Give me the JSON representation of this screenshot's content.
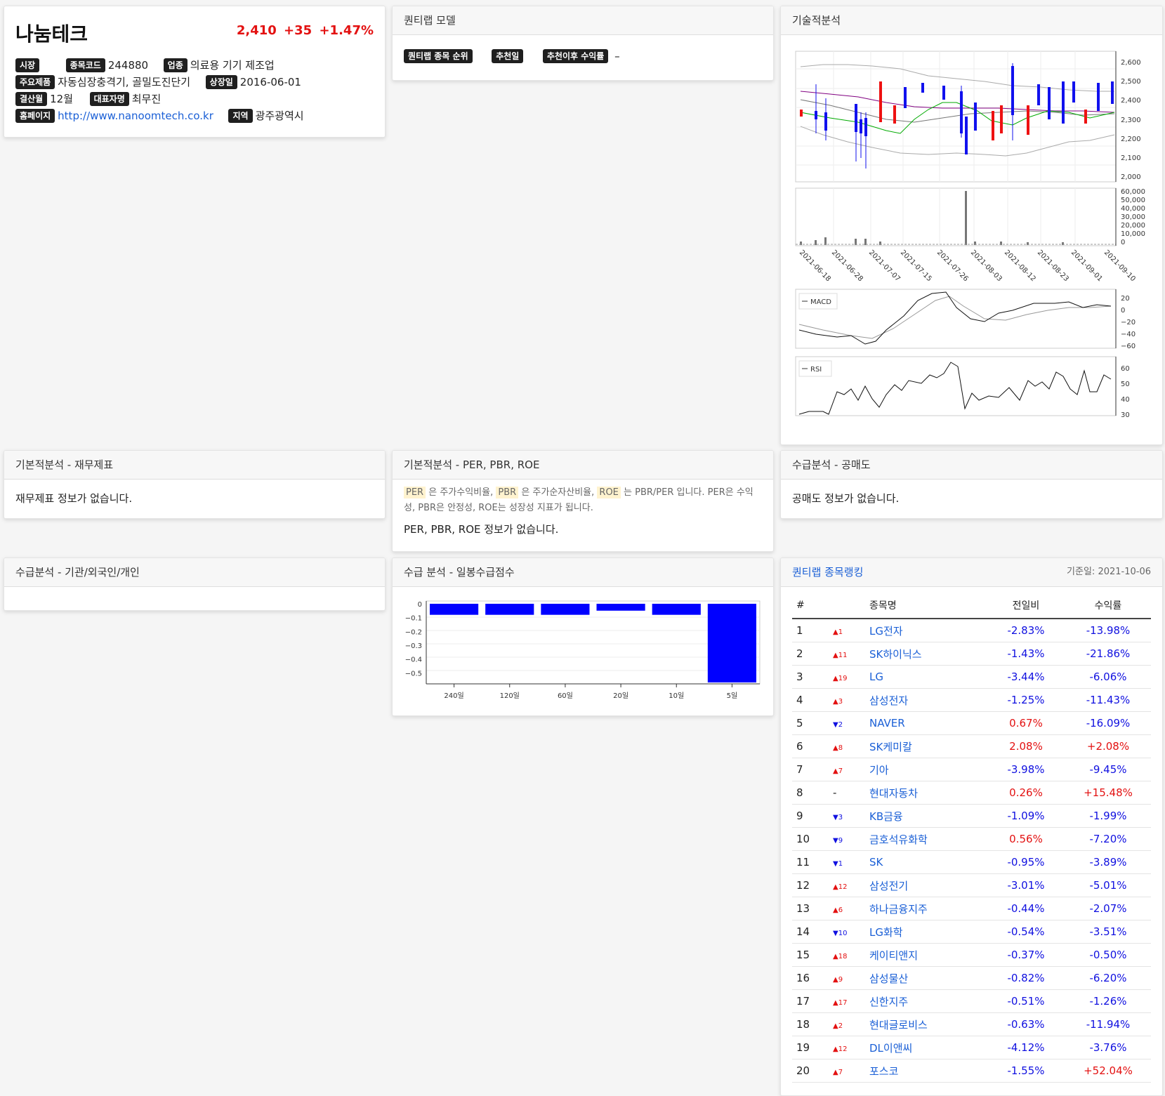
{
  "stock": {
    "name": "나눔테크",
    "price": "2,410",
    "change": "+35",
    "change_pct": "+1.47%",
    "market_label": "시장",
    "code_label": "종목코드",
    "code": "244880",
    "industry_label": "업종",
    "industry": "의료용 기기 제조업",
    "product_label": "주요제품",
    "product": "자동심장충격기, 골밀도진단기",
    "listing_label": "상장일",
    "listing_date": "2016-06-01",
    "fiscal_label": "결산월",
    "fiscal": "12월",
    "ceo_label": "대표자명",
    "ceo": "최무진",
    "homepage_label": "홈페이지",
    "homepage": "http://www.nanoomtech.co.kr",
    "region_label": "지역",
    "region": "광주광역시"
  },
  "quant_model": {
    "title": "퀀티랩 모델",
    "rank_badge": "퀀티랩 종목 순위",
    "date_badge": "추천일",
    "return_badge": "추천이후 수익률",
    "return_value": "–"
  },
  "tech": {
    "title": "기술적분석",
    "price_ticks": [
      "2,600",
      "2,500",
      "2,400",
      "2,300",
      "2,200",
      "2,100",
      "2,000"
    ],
    "volume_ticks": [
      "60,000",
      "50,000",
      "40,000",
      "30,000",
      "20,000",
      "10,000",
      "0"
    ],
    "date_ticks": [
      "2021-06-18",
      "2021-06-28",
      "2021-07-07",
      "2021-07-15",
      "2021-07-26",
      "2021-08-03",
      "2021-08-12",
      "2021-08-23",
      "2021-09-01",
      "2021-09-10"
    ],
    "macd_label": "MACD",
    "macd_ticks": [
      "20",
      "0",
      "−20",
      "−40",
      "−60"
    ],
    "rsi_label": "RSI",
    "rsi_ticks": [
      "60",
      "50",
      "40",
      "30"
    ]
  },
  "fin": {
    "title": "기본적분석 - 재무제표",
    "empty": "재무제표 정보가 없습니다."
  },
  "per": {
    "title": "기본적분석 - PER, PBR, ROE",
    "per": "PER",
    "per_text": "은 주가수익비율,",
    "pbr": "PBR",
    "pbr_text": "은 주가순자산비율,",
    "roe": "ROE",
    "roe_text": "는 PBR/PER 입니다. PER은 수익성, PBR은 안정성, ROE는 성장성 지표가 됩니다.",
    "empty": "PER, PBR, ROE 정보가 없습니다."
  },
  "short": {
    "title": "수급분석 - 공매도",
    "empty": "공매도 정보가 없습니다."
  },
  "investor": {
    "title": "수급분석 - 기관/외국인/개인"
  },
  "supply": {
    "title": "수급 분석 - 일봉수급점수",
    "y_ticks": [
      "0",
      "−0.1",
      "−0.2",
      "−0.3",
      "−0.4",
      "−0.5"
    ]
  },
  "supply_chart": {
    "type": "bar",
    "categories": [
      "240일",
      "120일",
      "60일",
      "20일",
      "10일",
      "5일"
    ],
    "values": [
      -0.08,
      -0.08,
      -0.08,
      -0.05,
      -0.08,
      -0.57
    ],
    "ylim": [
      -0.58,
      0.02
    ],
    "color": "#0000ff"
  },
  "ranking": {
    "title": "퀀티랩 종목랭킹",
    "date": "기준일: 2021-10-06",
    "headers": [
      "#",
      "종목명",
      "전일비",
      "수익률"
    ],
    "rows": [
      {
        "rank": "1",
        "dir": "up",
        "move": "1",
        "name": "LG전자",
        "chg": "-2.83%",
        "ret": "-13.98%"
      },
      {
        "rank": "2",
        "dir": "up",
        "move": "11",
        "name": "SK하이닉스",
        "chg": "-1.43%",
        "ret": "-21.86%"
      },
      {
        "rank": "3",
        "dir": "up",
        "move": "19",
        "name": "LG",
        "chg": "-3.44%",
        "ret": "-6.06%"
      },
      {
        "rank": "4",
        "dir": "up",
        "move": "3",
        "name": "삼성전자",
        "chg": "-1.25%",
        "ret": "-11.43%"
      },
      {
        "rank": "5",
        "dir": "down",
        "move": "2",
        "name": "NAVER",
        "chg": "0.67%",
        "ret": "-16.09%"
      },
      {
        "rank": "6",
        "dir": "up",
        "move": "8",
        "name": "SK케미칼",
        "chg": "2.08%",
        "ret": "+2.08%"
      },
      {
        "rank": "7",
        "dir": "up",
        "move": "7",
        "name": "기아",
        "chg": "-3.98%",
        "ret": "-9.45%"
      },
      {
        "rank": "8",
        "dir": "none",
        "move": "-",
        "name": "현대자동차",
        "chg": "0.26%",
        "ret": "+15.48%"
      },
      {
        "rank": "9",
        "dir": "down",
        "move": "3",
        "name": "KB금융",
        "chg": "-1.09%",
        "ret": "-1.99%"
      },
      {
        "rank": "10",
        "dir": "down",
        "move": "9",
        "name": "금호석유화학",
        "chg": "0.56%",
        "ret": "-7.20%"
      },
      {
        "rank": "11",
        "dir": "down",
        "move": "1",
        "name": "SK",
        "chg": "-0.95%",
        "ret": "-3.89%"
      },
      {
        "rank": "12",
        "dir": "up",
        "move": "12",
        "name": "삼성전기",
        "chg": "-3.01%",
        "ret": "-5.01%"
      },
      {
        "rank": "13",
        "dir": "up",
        "move": "6",
        "name": "하나금융지주",
        "chg": "-0.44%",
        "ret": "-2.07%"
      },
      {
        "rank": "14",
        "dir": "down",
        "move": "10",
        "name": "LG화학",
        "chg": "-0.54%",
        "ret": "-3.51%"
      },
      {
        "rank": "15",
        "dir": "up",
        "move": "18",
        "name": "케이티앤지",
        "chg": "-0.37%",
        "ret": "-0.50%"
      },
      {
        "rank": "16",
        "dir": "up",
        "move": "9",
        "name": "삼성물산",
        "chg": "-0.82%",
        "ret": "-6.20%"
      },
      {
        "rank": "17",
        "dir": "up",
        "move": "17",
        "name": "신한지주",
        "chg": "-0.51%",
        "ret": "-1.26%"
      },
      {
        "rank": "18",
        "dir": "up",
        "move": "2",
        "name": "현대글로비스",
        "chg": "-0.63%",
        "ret": "-11.94%"
      },
      {
        "rank": "19",
        "dir": "up",
        "move": "12",
        "name": "DL이앤씨",
        "chg": "-4.12%",
        "ret": "-3.76%"
      },
      {
        "rank": "20",
        "dir": "up",
        "move": "7",
        "name": "포스코",
        "chg": "-1.55%",
        "ret": "+52.04%"
      }
    ]
  }
}
